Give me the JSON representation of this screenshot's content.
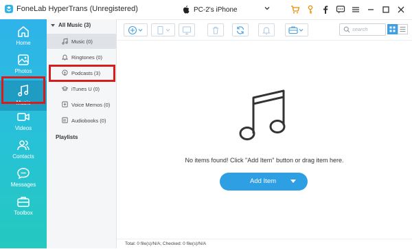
{
  "app": {
    "title": "FoneLab HyperTrans (Unregistered)",
    "device_name": "PC-2's iPhone",
    "accent": "#2f9fe4",
    "highlight_color": "#d81b1b"
  },
  "titlebar_icons": [
    "cart-icon",
    "key-icon",
    "facebook-icon",
    "chat-icon",
    "menu-icon",
    "minimize-icon",
    "maximize-icon",
    "close-icon"
  ],
  "sidebar": {
    "items": [
      {
        "label": "Home",
        "icon": "home-icon"
      },
      {
        "label": "Photos",
        "icon": "photos-icon"
      },
      {
        "label": "Music",
        "icon": "music-icon",
        "active": true
      },
      {
        "label": "Videos",
        "icon": "videos-icon"
      },
      {
        "label": "Contacts",
        "icon": "contacts-icon"
      },
      {
        "label": "Messages",
        "icon": "messages-icon"
      },
      {
        "label": "Toolbox",
        "icon": "toolbox-icon"
      }
    ]
  },
  "panel": {
    "all_music": "All Music (3)",
    "categories": [
      {
        "label": "Music (0)",
        "icon": "music-note-icon"
      },
      {
        "label": "Ringtones (0)",
        "icon": "bell-icon"
      },
      {
        "label": "Podcasts (3)",
        "icon": "podcast-icon"
      },
      {
        "label": "iTunes U (0)",
        "icon": "graduation-cap-icon"
      },
      {
        "label": "Voice Memos (0)",
        "icon": "voice-memo-icon"
      },
      {
        "label": "Audiobooks (0)",
        "icon": "audiobook-icon"
      }
    ],
    "playlists": "Playlists"
  },
  "toolbar": {
    "buttons": [
      "add-icon",
      "export-to-device-icon",
      "export-to-pc-icon",
      "delete-icon",
      "refresh-icon",
      "ringtone-icon",
      "toolbox-icon"
    ],
    "search_placeholder": "search"
  },
  "main": {
    "empty_text": "No items found! Click \"Add Item\" button or drag item here.",
    "add_button": "Add Item"
  },
  "status": {
    "text": "Total: 0 file(s)/N/A; Checked: 0 file(s)/N/A"
  }
}
